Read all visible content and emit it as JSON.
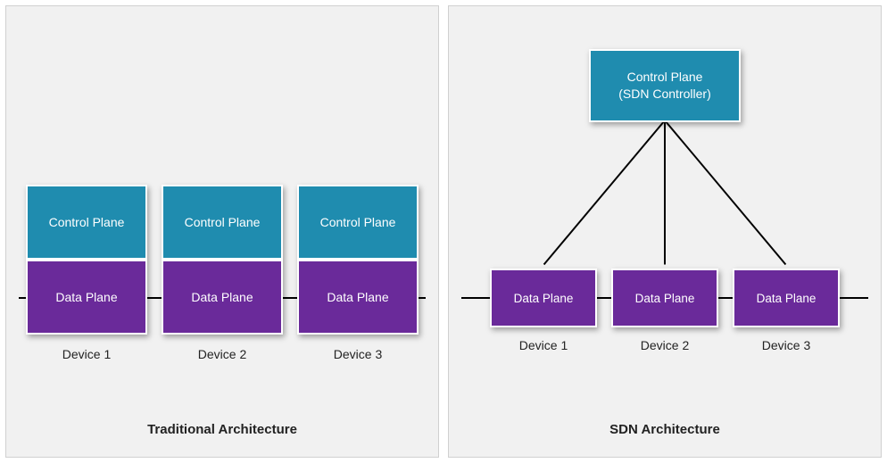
{
  "traditional": {
    "title": "Traditional Architecture",
    "devices": [
      {
        "control": "Control Plane",
        "data": "Data Plane",
        "label": "Device 1"
      },
      {
        "control": "Control Plane",
        "data": "Data Plane",
        "label": "Device 2"
      },
      {
        "control": "Control Plane",
        "data": "Data Plane",
        "label": "Device 3"
      }
    ]
  },
  "sdn": {
    "title": "SDN Architecture",
    "controller": {
      "line1": "Control Plane",
      "line2": "(SDN Controller)"
    },
    "devices": [
      {
        "data": "Data Plane",
        "label": "Device 1"
      },
      {
        "data": "Data Plane",
        "label": "Device 2"
      },
      {
        "data": "Data Plane",
        "label": "Device 3"
      }
    ]
  },
  "colors": {
    "control": "#1f8caf",
    "data": "#6a2a9a",
    "panel_bg": "#f1f1f1"
  }
}
